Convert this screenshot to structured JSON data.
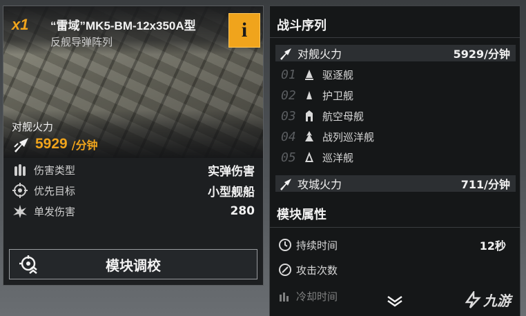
{
  "module": {
    "quantity": "x1",
    "name": "“雷域”MK5-BM-12x350A型",
    "type": "反舰导弹阵列",
    "info_icon": "i",
    "firepower_label": "对舰火力",
    "firepower_value": "5929",
    "firepower_unit": "/分钟",
    "stats": [
      {
        "icon": "bullets-icon",
        "label": "伤害类型",
        "value": "实弹伤害"
      },
      {
        "icon": "crosshair-icon",
        "label": "优先目标",
        "value": "小型舰船"
      },
      {
        "icon": "burst-icon",
        "label": "单发伤害",
        "value": "280"
      }
    ],
    "calibrate_label": "模块调校"
  },
  "battle_order": {
    "title": "战斗序列",
    "anti_ship": {
      "label": "对舰火力",
      "value": "5929/分钟"
    },
    "ships": [
      {
        "index": "01",
        "label": "驱逐舰"
      },
      {
        "index": "02",
        "label": "护卫舰"
      },
      {
        "index": "03",
        "label": "航空母舰"
      },
      {
        "index": "04",
        "label": "战列巡洋舰"
      },
      {
        "index": "05",
        "label": "巡洋舰"
      }
    ],
    "siege": {
      "label": "攻城火力",
      "value": "711/分钟"
    }
  },
  "attributes": {
    "title": "模块属性",
    "rows": [
      {
        "icon": "clock-icon",
        "label": "持续时间",
        "value": "12秒"
      },
      {
        "icon": "strike-icon",
        "label": "攻击次数",
        "value": ""
      },
      {
        "icon": "cooldown-icon",
        "label": "冷却时间",
        "value": ""
      }
    ]
  },
  "watermark": {
    "text": "九游"
  },
  "colors": {
    "accent": "#f0a41c",
    "panel": "#151718",
    "card": "#1d1f21"
  }
}
